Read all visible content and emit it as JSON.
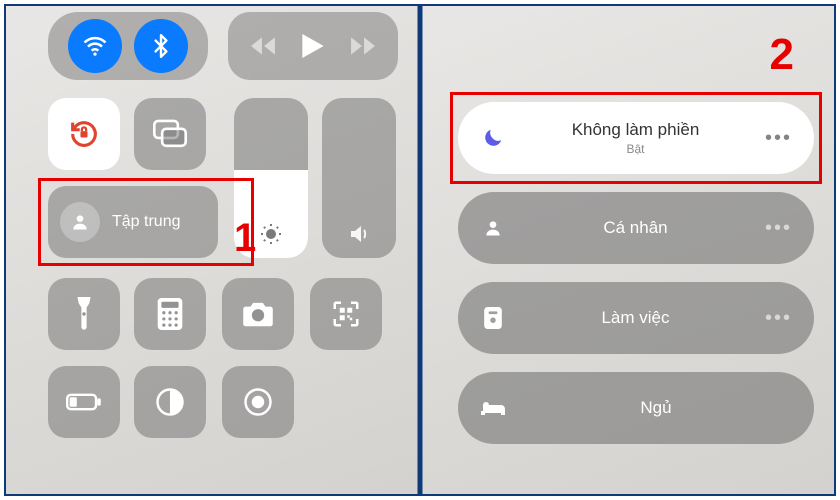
{
  "annotations": {
    "step1": "1",
    "step2": "2"
  },
  "left": {
    "focus_label": "Tập trung"
  },
  "right": {
    "dnd": {
      "title": "Không làm phiền",
      "subtitle": "Bật"
    },
    "personal": {
      "title": "Cá nhân"
    },
    "work": {
      "title": "Làm việc"
    },
    "sleep": {
      "title": "Ngủ"
    }
  }
}
